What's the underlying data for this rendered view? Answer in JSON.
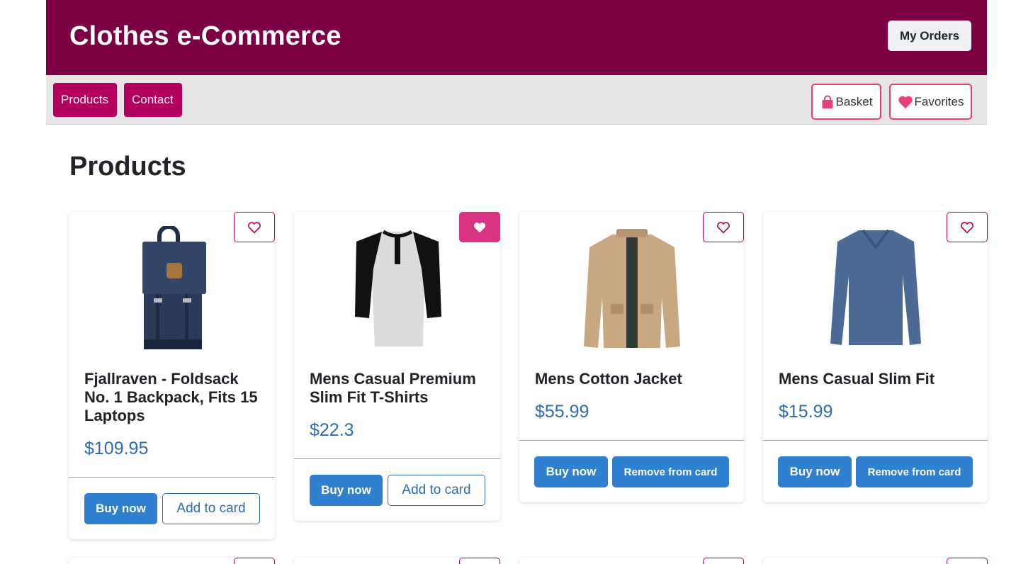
{
  "header": {
    "title": "Clothes e-Commerce",
    "orders_label": "My Orders",
    "brand_color": "#7a0043"
  },
  "nav": {
    "links": [
      "Products",
      "Contact"
    ],
    "basket_label": "Basket",
    "favorites_label": "Favorites",
    "accent_color": "#b3005e"
  },
  "page": {
    "heading": "Products"
  },
  "products": [
    {
      "title": "Fjallraven - Foldsack No. 1 Backpack, Fits 15 Laptops",
      "price": "$109.95",
      "favorite": false,
      "buy_label": "Buy now",
      "card_label": "Add to card",
      "image": "backpack"
    },
    {
      "title": "Mens Casual Premium Slim Fit T-Shirts",
      "price": "$22.3",
      "favorite": true,
      "buy_label": "Buy now",
      "card_label": "Add to card",
      "image": "raglan-tshirt"
    },
    {
      "title": "Mens Cotton Jacket",
      "price": "$55.99",
      "favorite": false,
      "buy_label": "Buy now",
      "card_label": "Remove from card",
      "image": "cotton-jacket"
    },
    {
      "title": "Mens Casual Slim Fit",
      "price": "$15.99",
      "favorite": false,
      "buy_label": "Buy now",
      "card_label": "Remove from card",
      "image": "long-sleeve-shirt"
    }
  ],
  "icons": {
    "basket": "shopping-bag-icon",
    "favorites": "heart-icon",
    "favorite_toggle": "heart-outline-icon"
  }
}
